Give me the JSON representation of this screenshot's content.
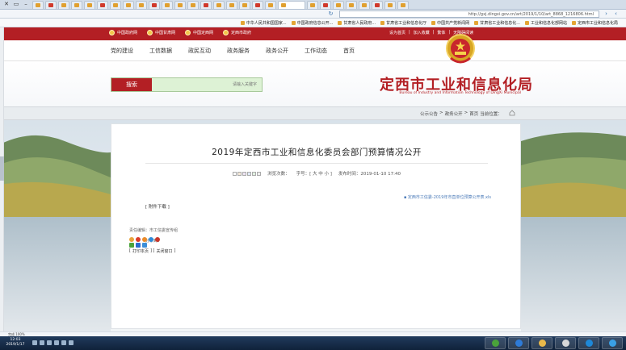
{
  "browser": {
    "address": "http://gxj.dingxi.gov.cn/art/2019/1/10/art_8868_1216806.html",
    "bookmarks": [
      "中华人民共和国国家...",
      "中国政府信息公开...",
      "甘肃省人民政府...",
      "甘肃省工业和信息化厅",
      "中国共产党新闻网",
      "甘肃省工业和信息化...",
      "工业和信息化部网站",
      "定西市工业和信息化局"
    ]
  },
  "site": {
    "top_links": [
      "中国政府网",
      "中国甘肃网",
      "中国定西网",
      "定西市政府"
    ],
    "user_links": [
      "设为首页",
      "加入收藏",
      "繁体",
      "无障碍阅读"
    ],
    "menu": [
      "首页",
      "工作动态",
      "政务公开",
      "政务服务",
      "政民互动",
      "工信数据",
      "党的建设"
    ],
    "logo_cn": "定西市工业和信息化局",
    "logo_en": "Bureau of Industry and Information Technology of DingXi Municipal",
    "search_placeholder": "请输入关键字",
    "search_button": "搜索"
  },
  "breadcrumb": [
    "当前位置：",
    "首页",
    ">",
    "政务公开",
    ">",
    "公示公告"
  ],
  "article": {
    "title": "2019年定西市工业和信息化委员会部门预算情况公开",
    "date": "发布时间：2019-01-10 17:40",
    "font_size": "字号：[ 大 中 小 ]",
    "views": "浏览次数：",
    "attachment_label": "[ 附件下载 ]",
    "attachment_file": "定西市工信委-2019年市直单位预算公开表.xls",
    "note": "责任编辑：市工信委宣传组",
    "share_label": "分享到：",
    "actions": [
      "打印本页",
      "关闭窗口"
    ]
  },
  "statusbar": "完成 100%",
  "taskbar": {
    "time": "12:03",
    "date": "2019/1/17"
  },
  "colors": {
    "brand_red": "#b31f24",
    "search_bg": "#ddf2d5"
  }
}
